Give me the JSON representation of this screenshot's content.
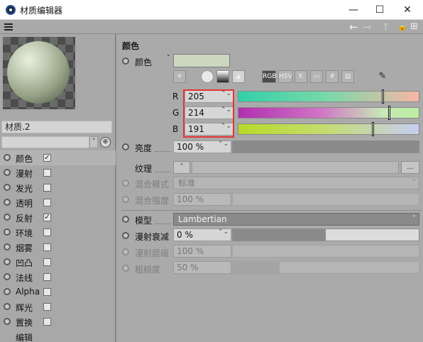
{
  "window": {
    "title": "材质编辑器",
    "minimize": "—",
    "maximize": "☐",
    "close": "✕"
  },
  "toolbar": {
    "back": "←",
    "forward": "→",
    "up": "↑",
    "lock": "🔒",
    "newwin": "⊞"
  },
  "material": {
    "name": "材质.2",
    "target": "⊕"
  },
  "channels": [
    {
      "label": "颜色",
      "checked": true,
      "mark": "✓"
    },
    {
      "label": "漫射",
      "checked": false,
      "mark": ""
    },
    {
      "label": "发光",
      "checked": false,
      "mark": ""
    },
    {
      "label": "透明",
      "checked": false,
      "mark": ""
    },
    {
      "label": "反射",
      "checked": true,
      "mark": "✓"
    },
    {
      "label": "环境",
      "checked": false,
      "mark": ""
    },
    {
      "label": "烟雾",
      "checked": false,
      "mark": ""
    },
    {
      "label": "凹凸",
      "checked": false,
      "mark": ""
    },
    {
      "label": "法线",
      "checked": false,
      "mark": ""
    },
    {
      "label": "Alpha",
      "checked": false,
      "mark": ""
    },
    {
      "label": "辉光",
      "checked": false,
      "mark": ""
    },
    {
      "label": "置换",
      "checked": false,
      "mark": ""
    },
    {
      "label": "编辑",
      "checked": null,
      "mark": ""
    }
  ],
  "color_section": {
    "title": "颜色",
    "color_label": "颜色",
    "dropdown_arrow": "˅",
    "swatch_hex": "#cdd6bf",
    "modes": [
      "RGB",
      "HSV",
      "K",
      "▭",
      "#",
      "▤"
    ],
    "eyedropper": "✎",
    "channels": [
      {
        "name": "R",
        "value": "205",
        "fraction": 0.804
      },
      {
        "name": "G",
        "value": "214",
        "fraction": 0.839
      },
      {
        "name": "B",
        "value": "191",
        "fraction": 0.749
      }
    ],
    "spin": "⌃⌄"
  },
  "brightness": {
    "label": "亮度",
    "value": "100 %",
    "fraction": 1.0
  },
  "texture": {
    "label": "纹理",
    "dropdown": "˅",
    "more": "..."
  },
  "blend_mode": {
    "label": "混合模式",
    "value": "标准"
  },
  "blend_strength": {
    "label": "混合强度",
    "value": "100 %"
  },
  "model": {
    "label": "模型",
    "value": "Lambertian"
  },
  "diffuse_falloff": {
    "label": "漫射衰减",
    "value": "0 %",
    "fraction": 0.5
  },
  "diffuse_level": {
    "label": "漫射层级",
    "value": "100 %"
  },
  "roughness": {
    "label": "粗糙度",
    "value": "50 %",
    "fraction": 0.25
  }
}
